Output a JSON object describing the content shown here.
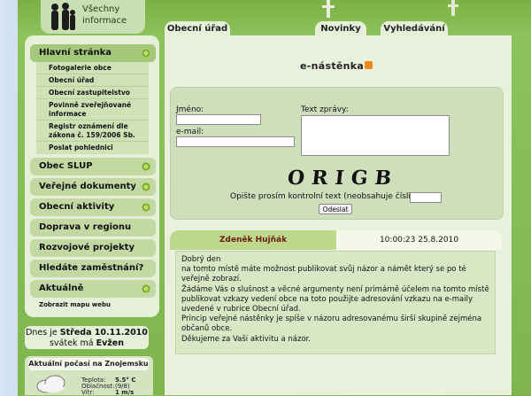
{
  "header": {
    "logo_label_1": "Všechny",
    "logo_label_2": "informace",
    "tabs": [
      "Obecní úřad",
      "Novinky",
      "Vyhledávání"
    ]
  },
  "sidebar": {
    "home": "Hlavní stránka",
    "sub_items": [
      "Fotogalerie obce",
      "Obecní úřad",
      "Obecní zastupitelstvo",
      "Povinně zveřejňované informace",
      "Registr oznámení dle zákona č. 159/2006 Sb.",
      "Poslat pohlednici"
    ],
    "items": [
      "Obec SLUP",
      "Veřejné dokumenty",
      "Obecní aktivity",
      "Doprava v regionu",
      "Rozvojové projekty",
      "Hledáte zaměstnání?",
      "Aktuálně"
    ],
    "map_link": "Zobrazit mapu webu"
  },
  "date_box": {
    "line1_prefix": "Dnes je",
    "day": "Středa 10.11.2010",
    "line2_prefix": "svátek má",
    "name": "Evžen"
  },
  "weather": {
    "title": "Aktuální počasí na Znojemsku",
    "rows": [
      {
        "label": "Teplota:",
        "value": "5.5° C"
      },
      {
        "label": "Oblačnost:",
        "value": "(9/8)"
      },
      {
        "label": "Vítr:",
        "value": "1 m/s"
      }
    ]
  },
  "main": {
    "title": "e-nástěnka",
    "form": {
      "name_label": "Jméno:",
      "email_label": "e-mail:",
      "message_label": "Text zprávy:",
      "captcha_text": "ORIGB",
      "captcha_prompt": "Opište prosím kontrolní text (neobsahuje číslice):",
      "submit_label": "Odeslat"
    },
    "message": {
      "author": "Zdeněk Hujňák",
      "datetime": "10:00:23 25.8.2010",
      "lines": [
        "Dobrý den",
        "na tomto místě máte možnost publikovat svůj názor a námět který se po té veřejně zobrazí.",
        "Žádáme Vás o slušnost a věcné argumenty není primárně účelem na tomto místě publikovat vzkazy vedení obce na toto použijte adresování vzkazu na e-maily uvedené v rubrice Obecní úřad.",
        "Princip veřejné nástěnky je spíše v názoru adresovanému širší skupině zejména občanů obce.",
        "Děkujeme za Vaši aktivitu a názor."
      ]
    }
  },
  "colors": {
    "brand_green": "#86bb52",
    "panel": "#e9f1dc",
    "author_red": "#6a1c10"
  }
}
